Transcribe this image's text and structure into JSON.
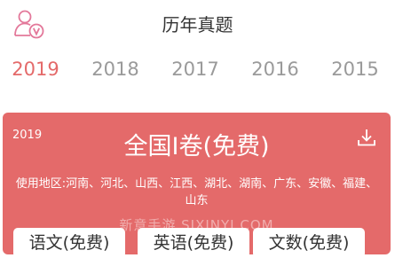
{
  "header": {
    "title": "历年真题"
  },
  "year_tabs": [
    {
      "label": "2019",
      "active": true
    },
    {
      "label": "2018",
      "active": false
    },
    {
      "label": "2017",
      "active": false
    },
    {
      "label": "2016",
      "active": false
    },
    {
      "label": "2015",
      "active": false
    }
  ],
  "card": {
    "year": "2019",
    "title": "全国I卷(免费)",
    "regions": "使用地区:河南、河北、山西、江西、湖北、湖南、广东、安徽、福建、山东",
    "watermark": "新意手游 SJXINYI.COM",
    "subjects": [
      "语文(免费)",
      "英语(免费)",
      "文数(免费)"
    ]
  },
  "colors": {
    "accent": "#e46a6a",
    "avatar_icon": "#e3789a",
    "tab_inactive": "#9a9a9a"
  },
  "icons": [
    "user-vip-icon",
    "download-icon"
  ]
}
